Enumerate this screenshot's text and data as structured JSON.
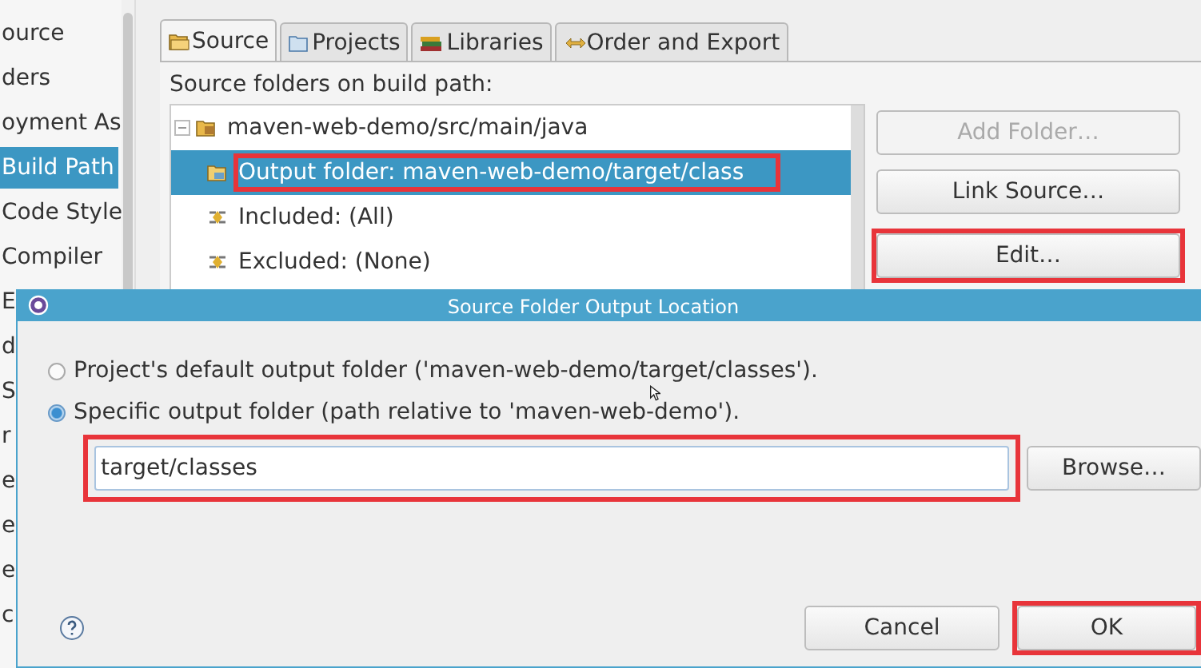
{
  "sidebar": {
    "items": [
      {
        "label": "ource",
        "selected": false
      },
      {
        "label": "ders",
        "selected": false
      },
      {
        "label": "oyment As",
        "selected": false
      },
      {
        "label": "Build Path",
        "selected": true
      },
      {
        "label": "Code Style",
        "selected": false
      },
      {
        "label": "Compiler",
        "selected": false
      },
      {
        "label": "E",
        "selected": false
      },
      {
        "label": "d",
        "selected": false
      },
      {
        "label": "S",
        "selected": false
      },
      {
        "label": "r",
        "selected": false
      },
      {
        "label": "e",
        "selected": false
      },
      {
        "label": "e",
        "selected": false
      },
      {
        "label": "e",
        "selected": false
      },
      {
        "label": "c",
        "selected": false
      }
    ]
  },
  "tabs": [
    {
      "label": "Source",
      "selected": true,
      "kind": "source"
    },
    {
      "label": "Projects",
      "selected": false,
      "kind": "projects"
    },
    {
      "label": "Libraries",
      "selected": false,
      "kind": "libraries"
    },
    {
      "label": "Order and Export",
      "selected": false,
      "kind": "order"
    }
  ],
  "source_panel": {
    "heading": "Source folders on build path:",
    "tree": [
      {
        "label": "maven-web-demo/src/main/java",
        "kind": "package",
        "expanded": true,
        "selected": false,
        "highlighted": false,
        "children": [
          {
            "label": "Output folder: maven-web-demo/target/class",
            "kind": "output",
            "selected": true,
            "highlighted": true
          },
          {
            "label": "Included: (All)",
            "kind": "filter",
            "selected": false,
            "highlighted": false
          },
          {
            "label": "Excluded: (None)",
            "kind": "filter",
            "selected": false,
            "highlighted": false
          }
        ]
      }
    ],
    "buttons": [
      {
        "label": "Add Folder…",
        "disabled": true,
        "highlighted": false
      },
      {
        "label": "Link Source…",
        "disabled": false,
        "highlighted": false
      },
      {
        "label": "Edit…",
        "disabled": false,
        "highlighted": true
      }
    ]
  },
  "dialog": {
    "title": "Source Folder Output Location",
    "options": [
      {
        "label": "Project's default output folder ('maven-web-demo/target/classes').",
        "selected": false
      },
      {
        "label": "Specific output folder (path relative to 'maven-web-demo').",
        "selected": true
      }
    ],
    "path_field": {
      "value": "target/classes",
      "highlighted": true
    },
    "browse_button": "Browse…",
    "buttons": [
      {
        "label": "Cancel",
        "highlighted": false
      },
      {
        "label": "OK",
        "highlighted": true
      }
    ]
  }
}
